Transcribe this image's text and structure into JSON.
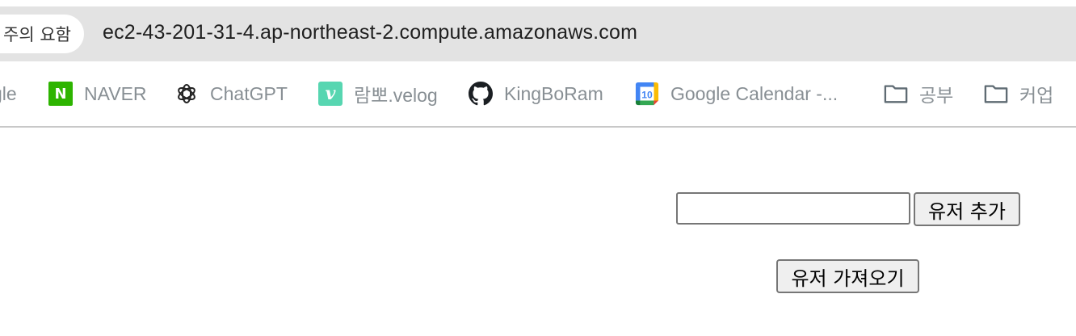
{
  "browser": {
    "security_chip_label": "주의 요함",
    "url": "ec2-43-201-31-4.ap-northeast-2.compute.amazonaws.com"
  },
  "bookmarks": [
    {
      "label": "gle",
      "icon": "google-icon"
    },
    {
      "label": "NAVER",
      "icon": "naver-icon",
      "icon_text": "N"
    },
    {
      "label": "ChatGPT",
      "icon": "chatgpt-icon"
    },
    {
      "label": "람뽀.velog",
      "icon": "velog-icon",
      "icon_text": "v"
    },
    {
      "label": "KingBoRam",
      "icon": "github-icon"
    },
    {
      "label": "Google Calendar -...",
      "icon": "google-calendar-icon",
      "icon_text": "10"
    },
    {
      "label": "공부",
      "icon": "folder-icon"
    },
    {
      "label": "커업",
      "icon": "folder-icon"
    }
  ],
  "page": {
    "user_input_value": "",
    "add_user_label": "유저 추가",
    "get_users_label": "유저 가져오기"
  },
  "colors": {
    "address_bar_bg": "#e3e3e3",
    "bookmark_text": "#888f94",
    "naver_green": "#2db400",
    "velog_green": "#20c997"
  }
}
